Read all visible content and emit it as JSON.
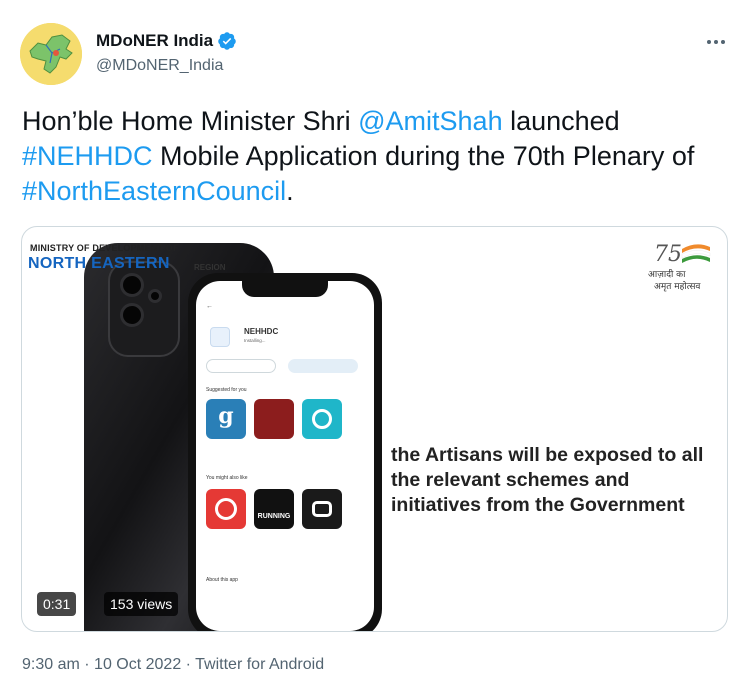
{
  "author": {
    "display_name": "MDoNER India",
    "handle": "@MDoNER_India",
    "verified": true
  },
  "tweet": {
    "segments": [
      {
        "type": "text",
        "value": "Hon’ble Home Minister Shri "
      },
      {
        "type": "mention",
        "value": "@AmitShah"
      },
      {
        "type": "text",
        "value": " launched "
      },
      {
        "type": "hashtag",
        "value": "#NEHHDC"
      },
      {
        "type": "text",
        "value": " Mobile Application during the 70th Plenary of "
      },
      {
        "type": "hashtag",
        "value": "#NorthEasternCouncil"
      },
      {
        "type": "text",
        "value": "."
      }
    ]
  },
  "media": {
    "ministry_line1": "MINISTRY OF DEVELOPMENT OF",
    "ministry_line2": "NORTH EASTERN",
    "ministry_region": "REGION",
    "azadi_number": "75",
    "azadi_line1": "आज़ादी का",
    "azadi_line2": "अमृत महोत्सव",
    "caption": "the Artisans will be exposed to all the relevant schemes and initiatives from the Government",
    "app_screen": {
      "app_name": "NEHHDC",
      "app_status": "Installing...",
      "suggested_label": "Suggested for you",
      "also_like_label": "You might also like",
      "about_label": "About this app"
    },
    "duration": "0:31",
    "views": "153 views"
  },
  "meta": {
    "time": "9:30 am",
    "separator": "·",
    "date": "10 Oct 2022",
    "source": "Twitter for Android"
  },
  "colors": {
    "link": "#1d9bf0",
    "text": "#0f1419",
    "secondary": "#536471"
  }
}
